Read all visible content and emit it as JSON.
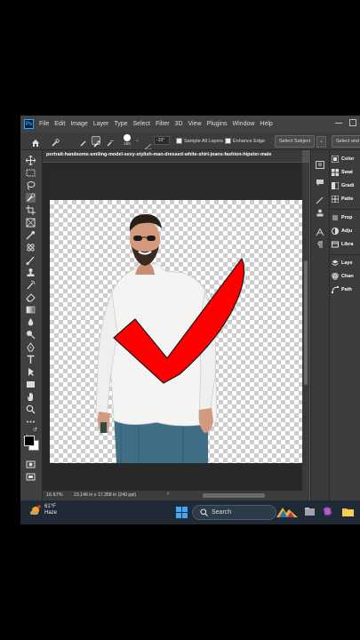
{
  "app": {
    "menu": [
      "File",
      "Edit",
      "Image",
      "Layer",
      "Type",
      "Select",
      "Filter",
      "3D",
      "View",
      "Plugins",
      "Window",
      "Help"
    ]
  },
  "options_bar": {
    "brush_size": "250",
    "angle": "-10°",
    "sample_all_layers": "Sample All Layers",
    "enhance_edge": "Enhance Edge",
    "select_subject": "Select Subject",
    "select_and_mask": "Select and"
  },
  "document": {
    "tab_title": "portrait-handsome-smiling-model-sexy-stylish-man-dressed-white-shirt-jeans-fashion-hipster-male",
    "close_glyph": "×"
  },
  "status": {
    "zoom": "16.67%",
    "doc_info": "23.146 in x 17.358 in (240 ppi)",
    "arrow": "›"
  },
  "panels": [
    {
      "icon": "color-icon",
      "label": "Color"
    },
    {
      "icon": "swatches-icon",
      "label": "Swat"
    },
    {
      "icon": "gradients-icon",
      "label": "Gradi"
    },
    {
      "icon": "patterns-icon",
      "label": "Patte"
    },
    {
      "icon": "properties-icon",
      "label": "Prop"
    },
    {
      "icon": "adjustments-icon",
      "label": "Adju"
    },
    {
      "icon": "libraries-icon",
      "label": "Libra"
    },
    {
      "icon": "layers-icon",
      "label": "Laye"
    },
    {
      "icon": "channels-icon",
      "label": "Chan"
    },
    {
      "icon": "paths-icon",
      "label": "Path"
    }
  ],
  "taskbar": {
    "temperature": "61°F",
    "condition": "Haze",
    "search_label": "Search"
  },
  "colors": {
    "checkmark": "#ff0000",
    "accent": "#31a8ff"
  }
}
